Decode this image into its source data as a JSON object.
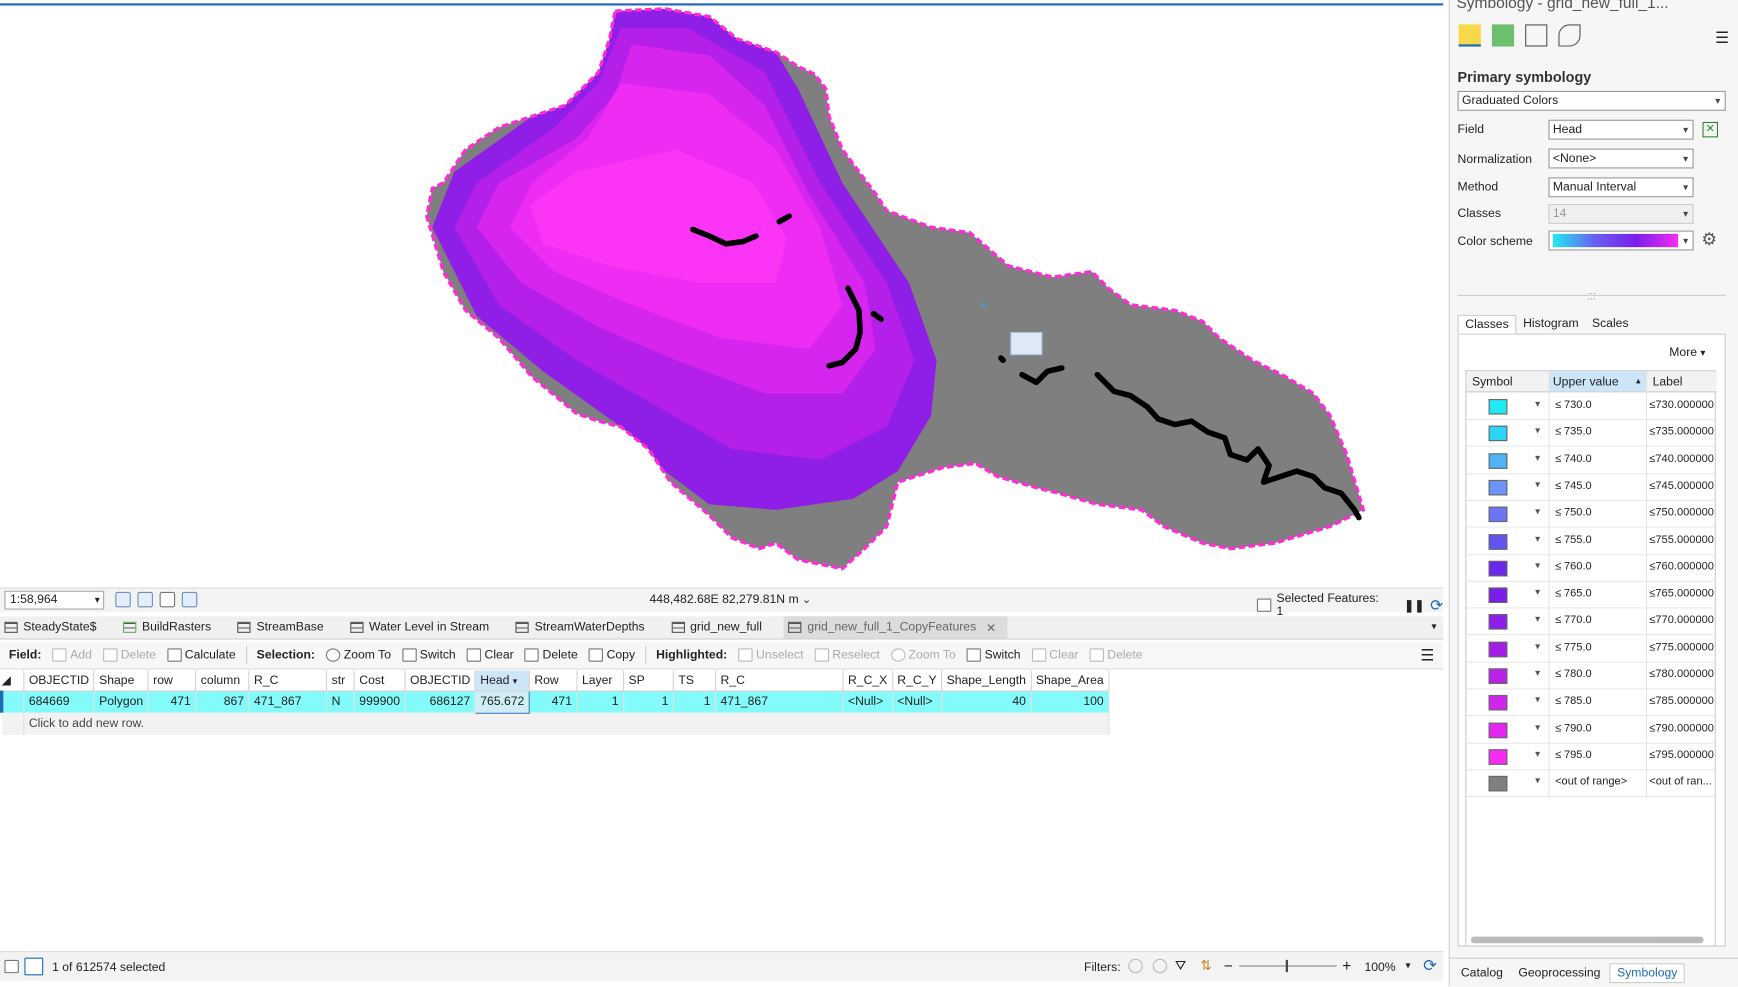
{
  "panel": {
    "title": "Symbology - grid_new_full_1...",
    "primary_symbology": "Primary symbology",
    "method_type": "Graduated Colors",
    "field_label": "Field",
    "field_value": "Head",
    "norm_label": "Normalization",
    "norm_value": "<None>",
    "method_label": "Method",
    "method_value": "Manual Interval",
    "classes_label": "Classes",
    "classes_value": "14",
    "scheme_label": "Color scheme",
    "tabs": [
      "Classes",
      "Histogram",
      "Scales"
    ],
    "more": "More",
    "headers": {
      "symbol": "Symbol",
      "upper": "Upper value",
      "label": "Label"
    },
    "classes": [
      {
        "color": "#22eaf2",
        "value": "730.0",
        "label": "≤730.000000"
      },
      {
        "color": "#2ad4f3",
        "value": "735.0",
        "label": "≤735.000000"
      },
      {
        "color": "#4eb4f5",
        "value": "740.0",
        "label": "≤740.000000"
      },
      {
        "color": "#6a94f5",
        "value": "745.0",
        "label": "≤745.000000"
      },
      {
        "color": "#6c74f3",
        "value": "750.0",
        "label": "≤750.000000"
      },
      {
        "color": "#6354ef",
        "value": "755.0",
        "label": "≤755.000000"
      },
      {
        "color": "#6a28ec",
        "value": "760.0",
        "label": "≤760.000000"
      },
      {
        "color": "#7a1ee9",
        "value": "765.0",
        "label": "≤765.000000"
      },
      {
        "color": "#8c1fe8",
        "value": "770.0",
        "label": "≤770.000000"
      },
      {
        "color": "#a31fe6",
        "value": "775.0",
        "label": "≤775.000000"
      },
      {
        "color": "#bb22e8",
        "value": "780.0",
        "label": "≤780.000000"
      },
      {
        "color": "#d124ec",
        "value": "785.0",
        "label": "≤785.000000"
      },
      {
        "color": "#e626f0",
        "value": "790.0",
        "label": "≤790.000000"
      },
      {
        "color": "#f52cf3",
        "value": "795.0",
        "label": "≤795.000000"
      },
      {
        "color": "#808080",
        "value": "<out of range>",
        "label": "<out of ran..."
      }
    ],
    "bottom_tabs": [
      "Catalog",
      "Geoprocessing",
      "Symbology"
    ]
  },
  "map": {
    "scale": "1:58,964",
    "coords": "448,482.68E 82,279.81N m",
    "selected": "Selected Features: 1"
  },
  "tabs": [
    "SteadyState$",
    "BuildRasters",
    "StreamBase",
    "Water Level in Stream",
    "StreamWaterDepths",
    "grid_new_full",
    "grid_new_full_1_CopyFeatures"
  ],
  "toolbar": {
    "field": "Field:",
    "add": "Add",
    "delete": "Delete",
    "calculate": "Calculate",
    "selection": "Selection:",
    "zoom_to": "Zoom To",
    "switch": "Switch",
    "clear": "Clear",
    "delete2": "Delete",
    "copy": "Copy",
    "highlighted": "Highlighted:",
    "unselect": "Unselect",
    "reselect": "Reselect",
    "zoom_to2": "Zoom To",
    "switch2": "Switch",
    "clear2": "Clear",
    "delete3": "Delete"
  },
  "table": {
    "columns": [
      "OBJECTID",
      "Shape",
      "row",
      "column",
      "R_C",
      "str",
      "Cost",
      "OBJECTID",
      "Head",
      "Row",
      "Layer",
      "SP",
      "TS",
      "R_C",
      "R_C_X",
      "R_C_Y",
      "Shape_Length",
      "Shape_Area"
    ],
    "row": [
      "684669",
      "Polygon",
      "471",
      "867",
      "471_867",
      "N",
      "999900",
      "686127",
      "765.672",
      "471",
      "1",
      "1",
      "1",
      "471_867",
      "<Null>",
      "<Null>",
      "40",
      "100"
    ],
    "add_row": "Click to add new row."
  },
  "status": {
    "selected": "1 of 612574 selected",
    "filters": "Filters:",
    "zoom": "100%"
  }
}
